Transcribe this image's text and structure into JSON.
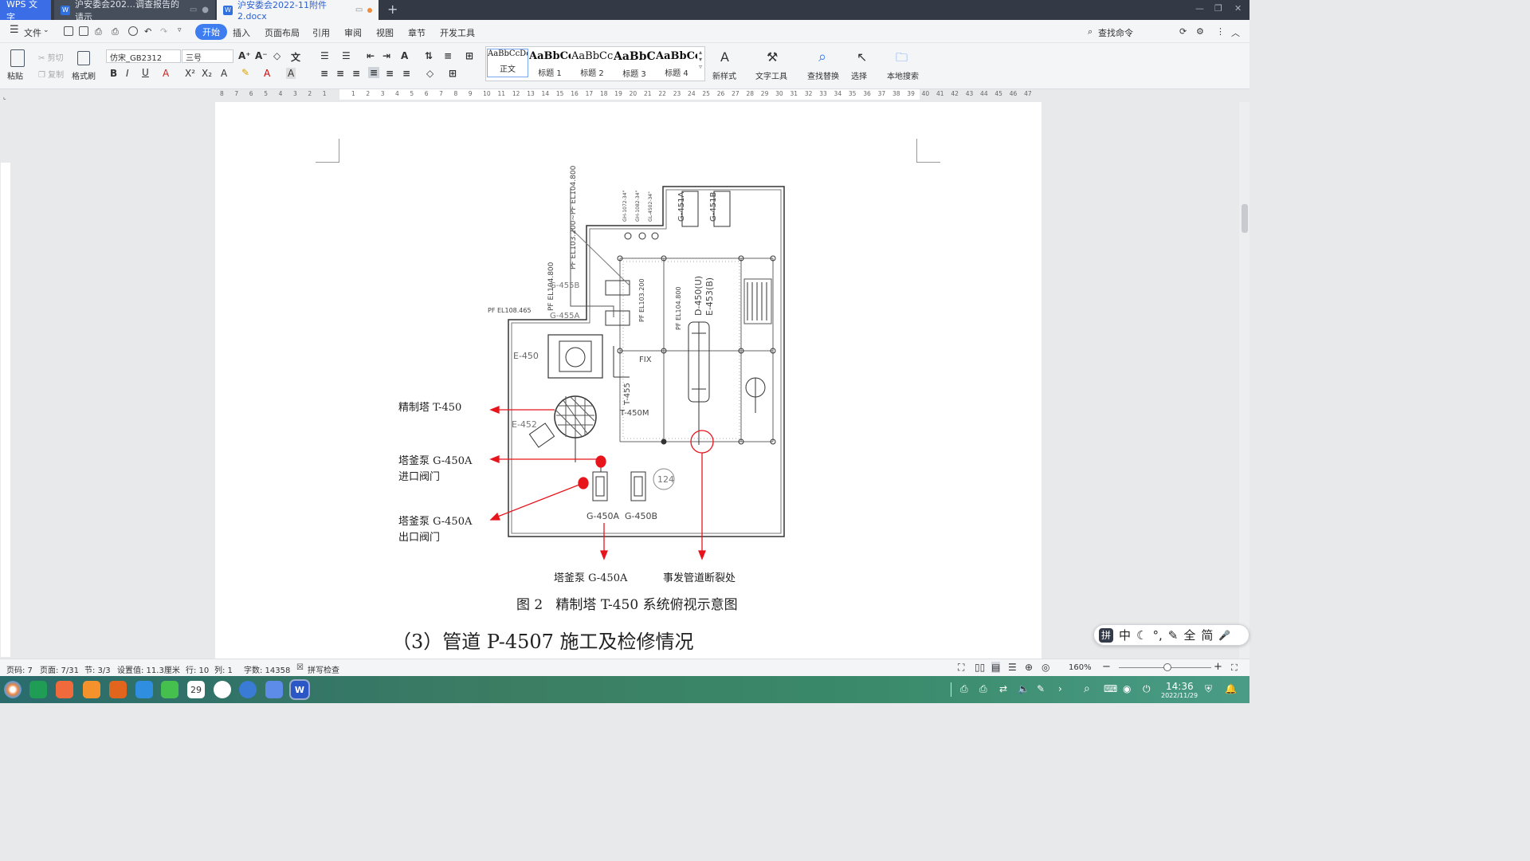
{
  "titlebar": {
    "app_label": "WPS 文字",
    "tabs": [
      {
        "label": "沪安委会202…调查报告的请示"
      },
      {
        "label": "沪安委会2022-11附件2.docx"
      }
    ],
    "new_tab": "+"
  },
  "menu": {
    "file": "文件",
    "items": [
      "开始",
      "插入",
      "页面布局",
      "引用",
      "审阅",
      "视图",
      "章节",
      "开发工具"
    ],
    "search": "查找命令"
  },
  "ribbon": {
    "paste": "粘贴",
    "cut": "剪切",
    "copy": "复制",
    "format_painter": "格式刷",
    "font_name": "仿宋_GB2312",
    "font_size": "三号",
    "styles": [
      {
        "preview": "AaBbCcDd",
        "name": "正文"
      },
      {
        "preview": "AaBbCc",
        "name": "标题 1"
      },
      {
        "preview": "AaBbCc",
        "name": "标题 2"
      },
      {
        "preview": "AaBbC",
        "name": "标题 3"
      },
      {
        "preview": "AaBbCc",
        "name": "标题 4"
      }
    ],
    "new_style": "新样式",
    "text_tools": "文字工具",
    "find_replace": "查找替换",
    "select": "选择",
    "local_search": "本地搜索"
  },
  "ruler": {
    "left_ticks": [
      "8",
      "7",
      "6",
      "5",
      "4",
      "3",
      "2",
      "1"
    ],
    "right_ticks": [
      "1",
      "2",
      "3",
      "4",
      "5",
      "6",
      "7",
      "8",
      "9",
      "10",
      "11",
      "12",
      "13",
      "14",
      "15",
      "16",
      "17",
      "18",
      "19",
      "20",
      "21",
      "22",
      "23",
      "24",
      "25",
      "26",
      "27",
      "28",
      "29",
      "30",
      "31",
      "32",
      "33",
      "34",
      "35",
      "36",
      "37",
      "38",
      "39",
      "40",
      "41",
      "42",
      "43",
      "44",
      "45",
      "46",
      "47"
    ]
  },
  "document": {
    "diagram": {
      "labels": {
        "g451a": "G-451A",
        "g451b": "G-451B",
        "pf_el104": "PF EL104.800",
        "pf_el103": "PF EL103.200~PF EL104.800",
        "g455b": "G-455B",
        "g455a": "G-455A",
        "pf_el108": "PF EL108.465",
        "pf_el103b": "PF EL103.200",
        "pf_el104b": "PF EL104.800",
        "d450": "D-450(U)",
        "e453": "E-453(B)",
        "e450": "E-450",
        "fix": "FIX",
        "t455": "T-455",
        "t450m": "T-450M",
        "e452": "E-452",
        "g450a": "G-450A",
        "g450b": "G-450B",
        "tag124": "124",
        "top_small": [
          "GH-1072-34\"",
          "GH-1082-34\"",
          "GL-4502-34\""
        ]
      },
      "callouts": {
        "tower": "精制塔 T-450",
        "inlet_valve": [
          "塔釜泵 G-450A",
          "进口阀门"
        ],
        "outlet_valve": [
          "塔釜泵 G-450A",
          "出口阀门"
        ],
        "pump_bottom": "塔釜泵 G-450A",
        "break_point": "事发管道断裂处"
      }
    },
    "figure_caption": "图 2   精制塔 T-450 系统俯视示意图",
    "heading": "（3）管道 P-4507 施工及检修情况"
  },
  "statusbar": {
    "page_code": "页码: 7",
    "page": "页面: 7/31",
    "section": "节: 3/3",
    "setting": "设置值: 11.3厘米",
    "row": "行: 10",
    "col": "列: 1",
    "words": "字数: 14358",
    "spell": "拼写检查",
    "zoom": "160%"
  },
  "ime": {
    "items": [
      "拼",
      "中",
      "☾",
      "°,",
      "✎",
      "全",
      "简",
      "🎤"
    ]
  },
  "taskbar": {
    "time": "14:36",
    "date": "2022/11/29",
    "calendar_day": "29"
  },
  "colors": {
    "accent": "#3d7df0",
    "callout_red": "#e8141c",
    "titlebar": "#333a45"
  }
}
